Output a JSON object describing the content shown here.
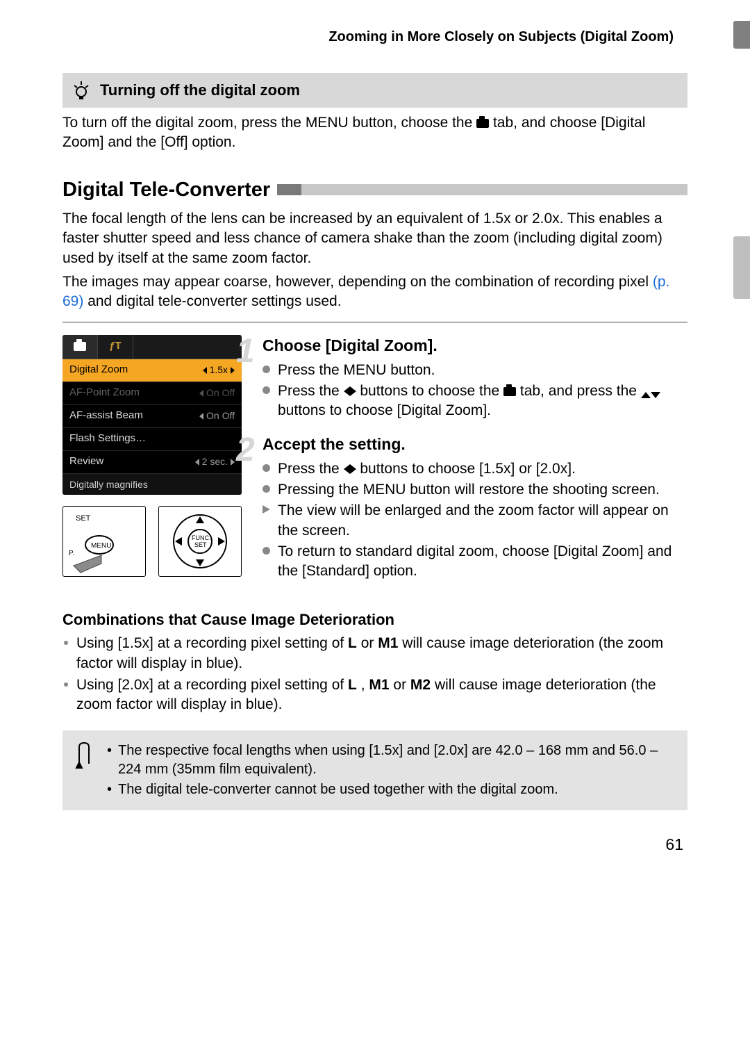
{
  "header": "Zooming in More Closely on Subjects (Digital Zoom)",
  "tip": {
    "title": "Turning off the digital zoom",
    "body_a": "To turn off the digital zoom, press the ",
    "body_b": " button, choose the ",
    "body_c": " tab, and choose [Digital Zoom] and the [Off] option.",
    "menu_label": "MENU"
  },
  "section_title": "Digital Tele-Converter",
  "para1": "The focal length of the lens can be increased by an equivalent of 1.5x or 2.0x. This enables a faster shutter speed and less chance of camera shake than the zoom (including digital zoom) used by itself at the same zoom factor.",
  "para2_a": "The images may appear coarse, however, depending on the combination of recording pixel ",
  "page_ref": "(p. 69)",
  "para2_b": " and digital tele-converter settings used.",
  "lcd": {
    "rows": [
      {
        "label": "Digital Zoom",
        "value": "1.5x",
        "hl": true
      },
      {
        "label": "AF-Point Zoom",
        "value": "On  Off",
        "dim": true
      },
      {
        "label": "AF-assist Beam",
        "value": "On  Off"
      },
      {
        "label": "Flash Settings…",
        "value": ""
      },
      {
        "label": "Review",
        "value": "2 sec."
      }
    ],
    "footer": "Digitally magnifies"
  },
  "steps": [
    {
      "num": "1",
      "title": "Choose [Digital Zoom].",
      "items": [
        {
          "pre": "Press the ",
          "glyph": "MENU",
          "post": " button."
        },
        {
          "pre": "Press the ",
          "glyph": "LR",
          "mid": " buttons to choose the ",
          "glyph2": "CAM",
          "post": " tab, and press the ",
          "glyph3": "UD",
          "tail": " buttons to choose [Digital Zoom]."
        }
      ]
    },
    {
      "num": "2",
      "title": "Accept the setting.",
      "items": [
        {
          "pre": "Press the ",
          "glyph": "LR",
          "post": " buttons to choose [1.5x] or [2.0x]."
        },
        {
          "pre": "Pressing the ",
          "glyph": "MENU",
          "post": " button will restore the shooting screen."
        },
        {
          "tri": true,
          "text": "The view will be enlarged and the zoom factor will appear on the screen."
        },
        {
          "text": "To return to standard digital zoom, choose [Digital Zoom] and the [Standard] option."
        }
      ]
    }
  ],
  "combo_head": "Combinations that Cause Image Deterioration",
  "combo_items": [
    {
      "a": "Using [1.5x] at a recording pixel setting of ",
      "g1": "L",
      "b": " or ",
      "g2": "M1",
      "c": " will cause image deterioration (the zoom factor will display in blue)."
    },
    {
      "a": "Using [2.0x] at a recording pixel setting of ",
      "g1": "L",
      "b": " , ",
      "g2": "M1",
      "c": " or ",
      "g3": "M2",
      "d": " will cause image deterioration (the zoom factor will display in blue)."
    }
  ],
  "notes": [
    "The respective focal lengths when using [1.5x] and [2.0x] are 42.0 – 168 mm and 56.0 – 224 mm (35mm film equivalent).",
    "The digital tele-converter cannot be used together with the digital zoom."
  ],
  "page_number": "61"
}
